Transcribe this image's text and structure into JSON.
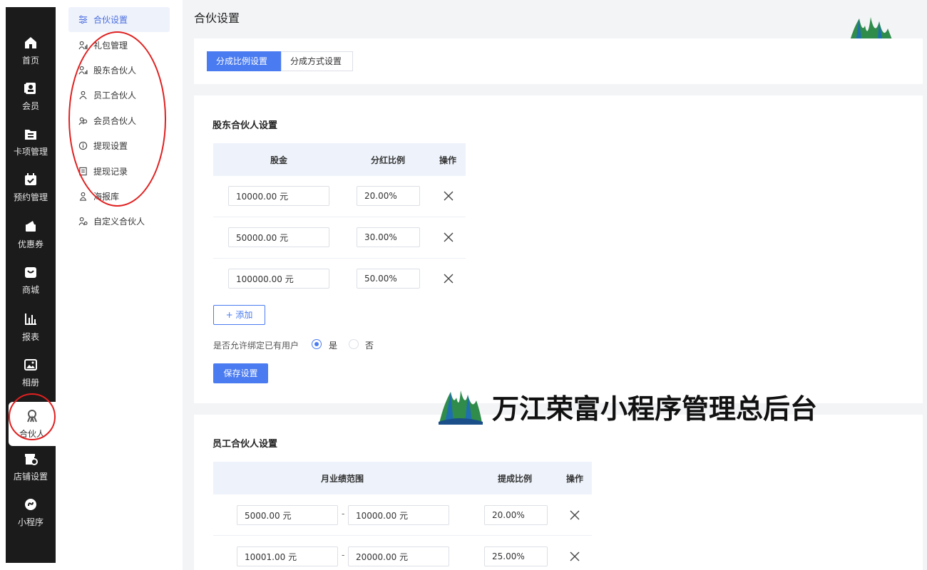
{
  "rail": {
    "items": [
      {
        "label": "首页",
        "icon": "home-icon"
      },
      {
        "label": "会员",
        "icon": "member-card-icon"
      },
      {
        "label": "卡项管理",
        "icon": "card-list-icon"
      },
      {
        "label": "预约管理",
        "icon": "calendar-check-icon"
      },
      {
        "label": "优惠券",
        "icon": "coupon-icon"
      },
      {
        "label": "商城",
        "icon": "shop-bag-icon"
      },
      {
        "label": "报表",
        "icon": "bar-chart-icon"
      },
      {
        "label": "相册",
        "icon": "image-icon"
      },
      {
        "label": "合伙人",
        "icon": "partner-icon"
      },
      {
        "label": "店铺设置",
        "icon": "store-settings-icon"
      },
      {
        "label": "小程序",
        "icon": "mini-program-icon"
      }
    ]
  },
  "subnav": {
    "items": [
      {
        "label": "合伙设置",
        "icon": "sliders-icon"
      },
      {
        "label": "礼包管理",
        "icon": "user-gift-icon"
      },
      {
        "label": "股东合伙人",
        "icon": "user-chart-icon"
      },
      {
        "label": "员工合伙人",
        "icon": "users-icon"
      },
      {
        "label": "会员合伙人",
        "icon": "user-group-icon"
      },
      {
        "label": "提现设置",
        "icon": "info-icon"
      },
      {
        "label": "提现记录",
        "icon": "record-icon"
      },
      {
        "label": "海报库",
        "icon": "user-poster-icon"
      },
      {
        "label": "自定义合伙人",
        "icon": "user-custom-icon"
      }
    ]
  },
  "page": {
    "title": "合伙设置"
  },
  "tabs": [
    "分成比例设置",
    "分成方式设置"
  ],
  "shareholder": {
    "title": "股东合伙人设置",
    "headers": [
      "股金",
      "分红比例",
      "操作"
    ],
    "rows": [
      {
        "capital": "10000.00 元",
        "ratio": "20.00%"
      },
      {
        "capital": "50000.00 元",
        "ratio": "30.00%"
      },
      {
        "capital": "100000.00 元",
        "ratio": "50.00%"
      }
    ],
    "add_label": "+ 添加",
    "bind_question": "是否允许绑定已有用户",
    "yes_label": "是",
    "no_label": "否",
    "bind_selected": "是",
    "save_label": "保存设置"
  },
  "employee": {
    "title": "员工合伙人设置",
    "headers": [
      "月业绩范围",
      "提成比例",
      "操作"
    ],
    "rows": [
      {
        "from": "5000.00 元",
        "to": "10000.00 元",
        "ratio": "20.00%"
      },
      {
        "from": "10001.00 元",
        "to": "20000.00 元",
        "ratio": "25.00%"
      }
    ],
    "range_separator": "-"
  },
  "watermark": {
    "text": "万江荣富小程序管理总后台"
  },
  "colors": {
    "accent": "#4a7bf0",
    "rail_bg": "#1b1b1b",
    "annotation_red": "#e02020"
  }
}
